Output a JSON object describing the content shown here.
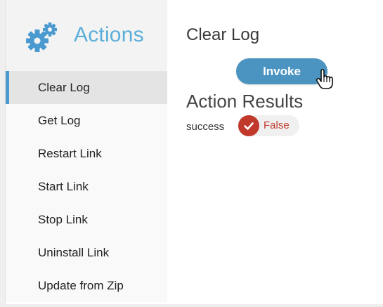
{
  "sidebar": {
    "header_title": "Actions",
    "header_icon": "gears-icon",
    "items": [
      {
        "label": "Clear Log",
        "active": true
      },
      {
        "label": "Get Log",
        "active": false
      },
      {
        "label": "Restart Link",
        "active": false
      },
      {
        "label": "Start Link",
        "active": false
      },
      {
        "label": "Stop Link",
        "active": false
      },
      {
        "label": "Uninstall Link",
        "active": false
      },
      {
        "label": "Update from Zip",
        "active": false
      }
    ]
  },
  "main": {
    "title": "Clear Log",
    "invoke_label": "Invoke",
    "results_title": "Action Results",
    "result": {
      "label": "success",
      "value": "False",
      "icon": "check-circle-icon"
    }
  },
  "colors": {
    "accent": "#5aaeda",
    "button": "#4b94c1",
    "active_indicator": "#4a9ad0",
    "status_red": "#c0392b"
  }
}
